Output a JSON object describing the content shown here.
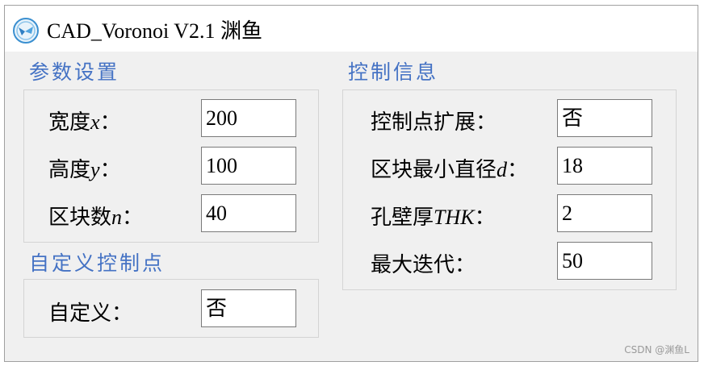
{
  "window": {
    "title": "CAD_Voronoi V2.1 渊鱼"
  },
  "params": {
    "title": "参数设置",
    "width_label": "宽度",
    "width_var": "x",
    "width_colon": "：",
    "width_value": "200",
    "height_label": "高度",
    "height_var": "y",
    "height_colon": "：",
    "height_value": "100",
    "blocks_label": "区块数",
    "blocks_var": "n",
    "blocks_colon": "：",
    "blocks_value": "40"
  },
  "custom": {
    "title": "自定义控制点",
    "label": "自定义：",
    "value": "否"
  },
  "control": {
    "title": "控制信息",
    "expand_label": "控制点扩展：",
    "expand_value": "否",
    "mindia_label": "区块最小直径",
    "mindia_var": "d",
    "mindia_colon": "：",
    "mindia_value": "18",
    "thk_label": "孔壁厚",
    "thk_var": "THK",
    "thk_colon": "：",
    "thk_value": "2",
    "iter_label": "最大迭代：",
    "iter_value": "50"
  },
  "watermark": "CSDN @渊鱼L",
  "colors": {
    "section_title": "#4472c4",
    "window_bg": "#f0f0f0"
  },
  "icons": {
    "app": "app-logo-icon"
  }
}
